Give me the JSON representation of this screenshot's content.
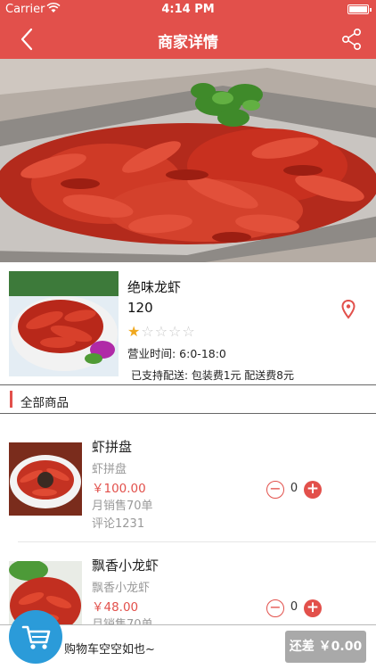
{
  "status_bar": {
    "carrier": "Carrier",
    "time": "4:14 PM"
  },
  "nav": {
    "title": "商家详情",
    "back_icon": "chevron-left-icon",
    "share_icon": "share-icon"
  },
  "shop": {
    "name": "绝味龙虾",
    "number": "120",
    "rating": 1,
    "rating_max": 5,
    "stars": "★☆☆☆☆",
    "hours": "营业时间: 6:0-18:0",
    "delivery": "已支持配送:  包装费1元 配送费8元"
  },
  "section": {
    "all_products": "全部商品"
  },
  "products": [
    {
      "name": "虾拼盘",
      "desc": "虾拼盘",
      "price": "￥100.00",
      "sales": "月销售70单",
      "comments": "评论1231",
      "qty": "0"
    },
    {
      "name": "飘香小龙虾",
      "desc": "飘香小龙虾",
      "price": "￥48.00",
      "sales": "月销售70单",
      "comments": "",
      "qty": "0"
    }
  ],
  "stepper": {
    "minus": "−",
    "plus": "+"
  },
  "cart": {
    "empty_text": "购物车空空如也~",
    "checkout_label": "还差 ￥0.00"
  },
  "colors": {
    "accent": "#e2504b",
    "cart_blue": "#2b9bd9",
    "checkout_gray": "#a9a9a9"
  }
}
